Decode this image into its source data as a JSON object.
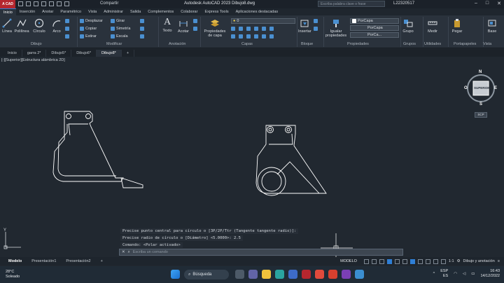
{
  "titlebar": {
    "app_label": "A CAD",
    "share": "Compartir",
    "title": "Autodesk AutoCAD 2023   Dibujo8.dwg",
    "search_placeholder": "Escriba palabra clave o frase",
    "user": "L22320517"
  },
  "menu_tabs": [
    "Inicio",
    "Inserción",
    "Anotar",
    "Paramétrico",
    "Vista",
    "Administrar",
    "Salida",
    "Complementos",
    "Colaborar",
    "Express Tools",
    "Aplicaciones destacadas"
  ],
  "ribbon": {
    "draw": {
      "linea": "Línea",
      "polilinea": "Polilínea",
      "circulo": "Círculo",
      "arco": "Arco",
      "panel": "Dibujo"
    },
    "modify": {
      "desplazar": "Desplazar",
      "girar": "Girar",
      "copiar": "Copiar",
      "simetria": "Simetría",
      "estirar": "Estirar",
      "escala": "Escala",
      "panel": "Modificar"
    },
    "annotation": {
      "texto": "Texto",
      "acotar": "Acotar",
      "panel": "Anotación"
    },
    "layers": {
      "propiedades": "Propiedades de capa",
      "panel": "Capas",
      "layer_value": "0"
    },
    "block": {
      "insertar": "Insertar",
      "panel": "Bloque"
    },
    "properties": {
      "igualar": "Igualar propiedades",
      "porcapa1": "PorCapa",
      "porcapa2": "PorCapa",
      "porcapa3": "PorCa...",
      "panel": "Propiedades"
    },
    "groups": {
      "grupo": "Grupo",
      "panel": "Grupos"
    },
    "utilities": {
      "medir": "Medir",
      "panel": "Utilidades"
    },
    "clipboard": {
      "pegar": "Pegar",
      "panel": "Portapapeles"
    },
    "view": {
      "base": "Base",
      "panel": "Vista"
    }
  },
  "doc_tabs": [
    "Inicio",
    "garra 2*",
    "Dibujo5*",
    "Dibujo6*",
    "Dibujo8*"
  ],
  "viewport_label": "[-][Superior][Estructura alámbrica 2D]",
  "viewcube": {
    "n": "N",
    "s": "S",
    "e": "E",
    "o": "O",
    "face": "SUPERIOR",
    "wcs": "SCP"
  },
  "command_history": [
    "Precise punto central para círculo o [3P/2P/Ttr (Tangente tangente radio)]:",
    "Precise radio de círculo o [Diámetro] <5.0000>: 2.5",
    "Comando:  <Polar activado>"
  ],
  "command_placeholder": "Escriba un comando",
  "layout_tabs": [
    "Modelo",
    "Presentación1",
    "Presentación2"
  ],
  "status": {
    "mode": "MODELO",
    "scale": "1:1",
    "workspace": "Dibujo y anotación"
  },
  "taskbar": {
    "temp": "28°C",
    "weather": "Soleado",
    "search": "Búsqueda",
    "lang1": "ESP",
    "lang2": "ES",
    "time": "16:43",
    "date": "14/12/2022"
  },
  "colors": {
    "accent": "#2f7fd6",
    "canvas": "#212830",
    "ribbon": "#2a323c",
    "app_red": "#b5262e"
  }
}
